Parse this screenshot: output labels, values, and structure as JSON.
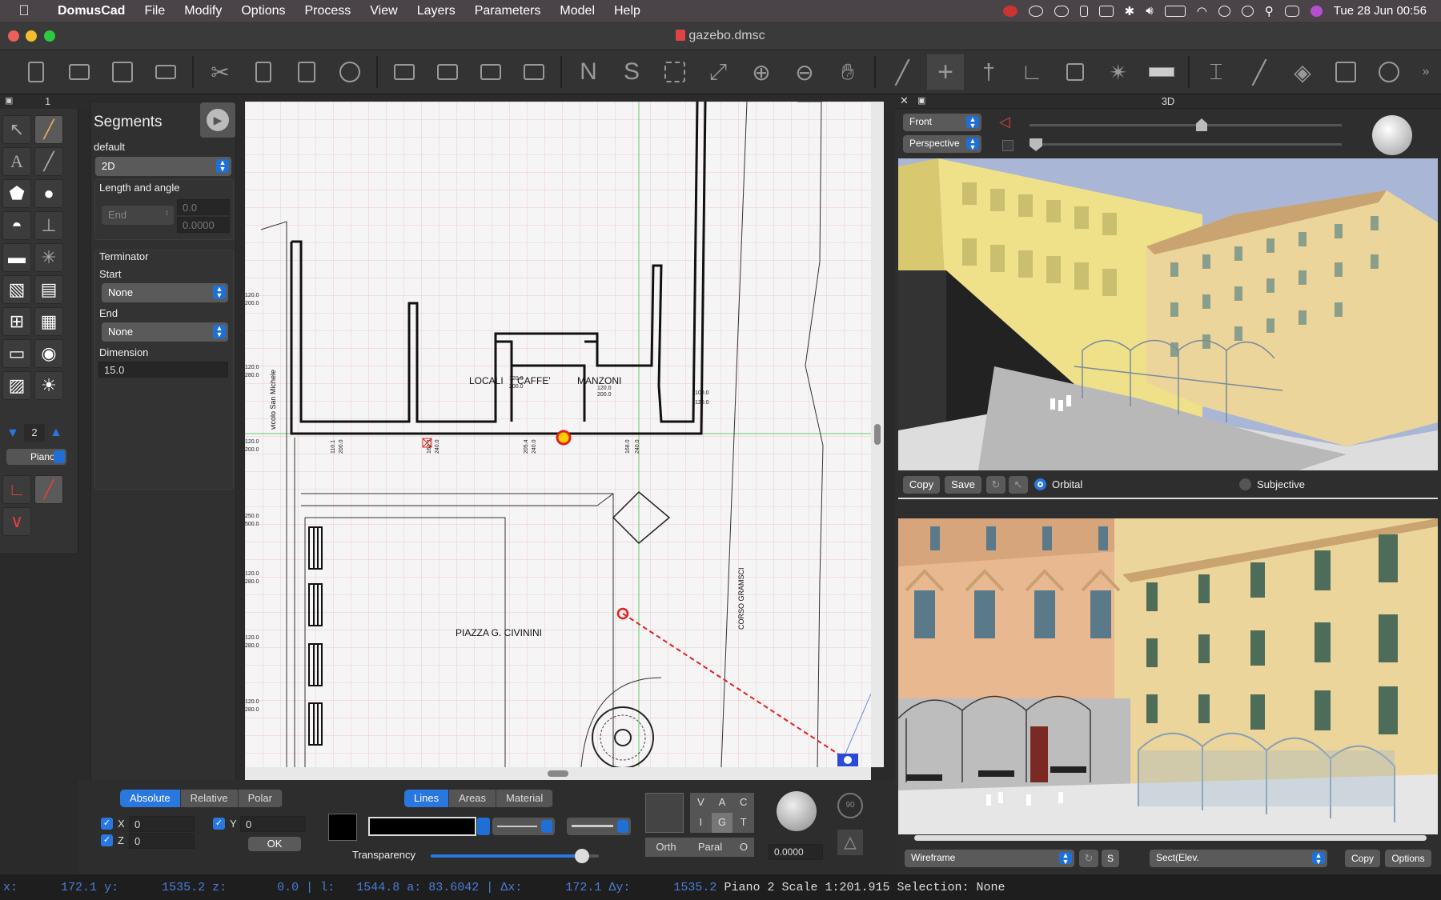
{
  "menubar": {
    "app_name": "DomusCad",
    "items": [
      "File",
      "Modify",
      "Options",
      "Process",
      "View",
      "Layers",
      "Parameters",
      "Model",
      "Help"
    ],
    "clock": "Tue 28 Jun  00:56"
  },
  "window": {
    "title": "gazebo.dmsc"
  },
  "tabs": {
    "left_number": "1",
    "right_title": "3D"
  },
  "segments_panel": {
    "title": "Segments",
    "default_label": "default",
    "mode_value": "2D",
    "length_angle_label": "Length and angle",
    "end_select": "End",
    "length_value": "0.0",
    "angle_value": "0.0000",
    "terminator_label": "Terminator",
    "start_label": "Start",
    "start_value": "None",
    "end_label": "End",
    "end_value": "None",
    "dimension_label": "Dimension",
    "dimension_value": "15.0"
  },
  "layer": {
    "number": "2",
    "name": "Piano"
  },
  "canvas": {
    "labels": {
      "locali": "LOCALI",
      "caffe": "CAFFE'",
      "manzoni": "MANZONI",
      "piazza": "PIAZZA G. CIVININI",
      "corso": "CORSO GRAMSCI",
      "vicolo": "vicolo San Michele"
    },
    "dims": [
      "120.0",
      "200.0",
      "120.0",
      "280.0",
      "120.0",
      "200.0",
      "250.0",
      "500.0",
      "120.0",
      "280.0",
      "120.0",
      "280.0",
      "120.0",
      "280.0",
      "100.0",
      "120.0",
      "110.1",
      "200.0",
      "162.3",
      "240.0",
      "205.4",
      "240.0",
      "168.0",
      "240.0",
      "120.0",
      "200.0",
      "120.0",
      "200.0"
    ]
  },
  "coords": {
    "tabs": [
      "Absolute",
      "Relative",
      "Polar"
    ],
    "x_label": "X",
    "x_value": "0",
    "y_label": "Y",
    "y_value": "0",
    "z_label": "Z",
    "z_value": "0",
    "ok_label": "OK"
  },
  "style": {
    "tabs": [
      "Lines",
      "Areas",
      "Material"
    ],
    "transparency_label": "Transparency",
    "transparency": 0.9
  },
  "view_letters": {
    "row1": [
      "V",
      "A",
      "C"
    ],
    "row2": [
      "I",
      "G",
      "T"
    ],
    "row3": [
      "Orth",
      "Paral",
      "O"
    ]
  },
  "rotation_value": "0.0000",
  "view3d": {
    "view_select": "Front",
    "projection_select": "Perspective",
    "copy_label": "Copy",
    "save_label": "Save",
    "orbital_label": "Orbital",
    "subjective_label": "Subjective",
    "render_select": "Wireframe",
    "s_label": "S",
    "section_select": "Sect(Elev.",
    "copy2_label": "Copy",
    "options_label": "Options"
  },
  "status": {
    "x_label": "x:",
    "x": "172.1",
    "y_label": "y:",
    "y": "1535.2",
    "z_label": "z:",
    "z": "0.0",
    "l_label": "l:",
    "l": "1544.8",
    "a_label": "a:",
    "a": "83.6042",
    "dx_label": "Δx:",
    "dx": "172.1",
    "dy_label": "Δy:",
    "dy": "1535.2",
    "layer": "Piano 2",
    "scale": "Scale 1:201.915",
    "selection": "Selection: None"
  },
  "colors": {
    "accent": "#2a77e0",
    "menubar": "#4a4448",
    "canvas_grid": "#f3c9c9",
    "facade_yellow": "#efe08a",
    "facade_cream": "#ecd59a"
  }
}
